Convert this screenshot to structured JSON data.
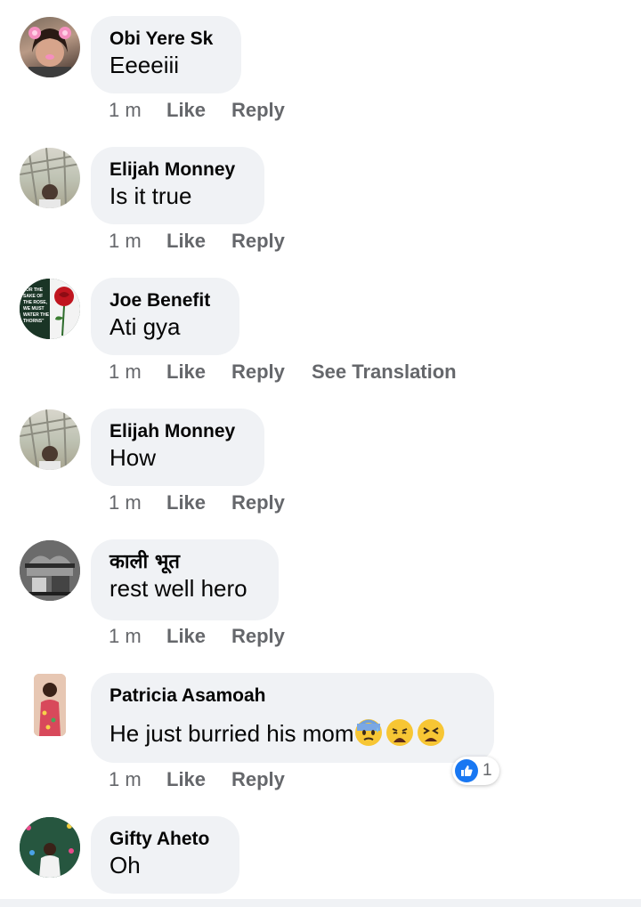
{
  "comments": [
    {
      "name": "Obi Yere Sk",
      "text": "Eeeeiii",
      "time": "1 m",
      "like": "Like",
      "reply": "Reply"
    },
    {
      "name": "Elijah Monney",
      "text": "Is it true",
      "time": "1 m",
      "like": "Like",
      "reply": "Reply"
    },
    {
      "name": "Joe Benefit",
      "text": "Ati gya",
      "time": "1 m",
      "like": "Like",
      "reply": "Reply",
      "translate": "See Translation"
    },
    {
      "name": "Elijah Monney",
      "text": "How",
      "time": "1 m",
      "like": "Like",
      "reply": "Reply"
    },
    {
      "name": "काली भूत",
      "text": "rest well hero",
      "time": "1 m",
      "like": "Like",
      "reply": "Reply"
    },
    {
      "name": "Patricia Asamoah",
      "text": "He just burried his mom",
      "time": "1 m",
      "like": "Like",
      "reply": "Reply",
      "reaction_count": "1"
    },
    {
      "name": "Gifty Aheto",
      "text": "Oh"
    }
  ],
  "avatar_text": {
    "joe": [
      "FOR THE",
      "SAKE OF",
      "THE ROSE,",
      "WE MUST",
      "WATER THE",
      "THORNS\""
    ]
  },
  "icons": {
    "emoji_1": "anxious-sweat-face-icon",
    "emoji_2": "weary-face-icon",
    "emoji_3": "tired-face-icon",
    "reaction": "thumbs-up-icon"
  }
}
